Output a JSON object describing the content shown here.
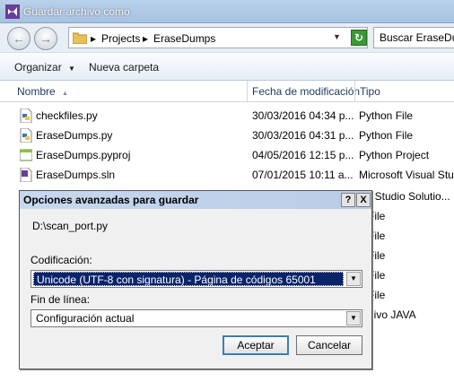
{
  "window": {
    "title": "Guardar archivo como"
  },
  "address": {
    "crumbs": [
      "Projects",
      "EraseDumps"
    ],
    "search_placeholder": "Buscar EraseDumps"
  },
  "toolbar": {
    "organize_label": "Organizar",
    "new_folder_label": "Nueva carpeta"
  },
  "columns": {
    "name": "Nombre",
    "date": "Fecha de modificación",
    "type": "Tipo"
  },
  "files": [
    {
      "name": "checkfiles.py",
      "date": "30/03/2016 04:34 p...",
      "type": "Python File",
      "icon": "python-file-icon"
    },
    {
      "name": "EraseDumps.py",
      "date": "30/03/2016 04:31 p...",
      "type": "Python File",
      "icon": "python-file-icon"
    },
    {
      "name": "EraseDumps.pyproj",
      "date": "04/05/2016 12:15 p...",
      "type": "Python Project",
      "icon": "python-project-icon"
    },
    {
      "name": "EraseDumps.sln",
      "date": "07/01/2015 10:11 a...",
      "type": "Microsoft Visual Stu...",
      "icon": "visual-studio-solution-icon"
    }
  ],
  "hidden_rows_types": [
    "al Studio Solutio...",
    "File",
    "File",
    "File",
    "File",
    "File",
    "hivo JAVA"
  ],
  "dialog": {
    "title": "Opciones avanzadas para guardar",
    "help_label": "?",
    "close_label": "X",
    "path": "D:\\scan_port.py",
    "encoding_label": "Codificación:",
    "encoding_value": "Unicode (UTF-8 con signatura) - Página de códigos 65001",
    "line_ending_label": "Fin de línea:",
    "line_ending_value": "Configuración actual",
    "accept_label": "Aceptar",
    "cancel_label": "Cancelar"
  }
}
